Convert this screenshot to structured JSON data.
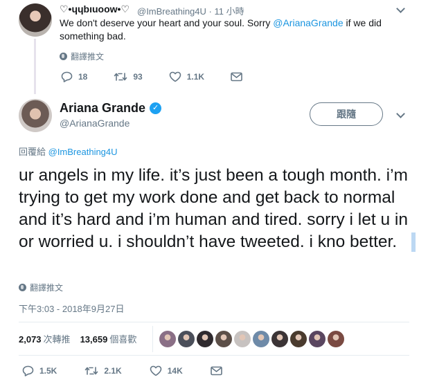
{
  "parent": {
    "display_name": "♡•ɥɥbıuoow•♡",
    "handle_time": "@ImBreathing4U · 11 小時",
    "text_before": "We don't deserve your heart and your soul. Sorry ",
    "mention": "@ArianaGrande",
    "text_after": " if we did something bad.",
    "translate": "翻譯推文",
    "replies": "18",
    "retweets": "93",
    "likes": "1.1K"
  },
  "tweet": {
    "display_name": "Ariana Grande",
    "handle": "@ArianaGrande",
    "follow_label": "跟隨",
    "reply_prefix": "回覆給 ",
    "reply_mention": "@ImBreathing4U",
    "text": "ur angels in my life. it’s just been a tough month. i’m trying to get my work done and get back to normal and it’s hard and i’m human and tired. sorry i let u in or worried u. i shouldn’t have tweeted. i kno better.",
    "translate": "翻譯推文",
    "timestamp": "下午3:03 - 2018年9月27日",
    "retweet_count": "2,073",
    "retweet_label": "次轉推",
    "like_count": "13,659",
    "like_label": "個喜歡",
    "replies": "1.5K",
    "retweets": "2.1K",
    "likes": "14K"
  },
  "liker_colors": [
    "#8a6f86",
    "#4b4f5a",
    "#2f2a2e",
    "#5c4f48",
    "#c7c2c0",
    "#6e8aa8",
    "#3b3436",
    "#4a3b2e",
    "#5a4660",
    "#7a4a42"
  ],
  "colors": {
    "text": "#14171a",
    "secondary": "#657786",
    "link": "#1b95e0",
    "verified": "#1da1f2"
  }
}
